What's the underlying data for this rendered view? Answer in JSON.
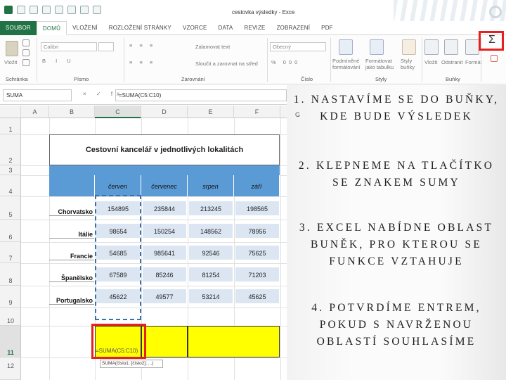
{
  "window": {
    "title": "cestovka výsledky - Exce"
  },
  "tabs": [
    {
      "label": "SOUBOR"
    },
    {
      "label": "DOMŮ"
    },
    {
      "label": "VLOŽENÍ"
    },
    {
      "label": "ROZLOŽENÍ STRÁNKY"
    },
    {
      "label": "VZORCE"
    },
    {
      "label": "DATA"
    },
    {
      "label": "REVIZE"
    },
    {
      "label": "ZOBRAZENÍ"
    },
    {
      "label": "PDF"
    }
  ],
  "ribbon": {
    "paste_label": "Vložit",
    "font_name": "Calibri",
    "wrap_text": "Zalamovat text",
    "merge_center": "Sloučit a zarovnat na střed",
    "number_format": "Obecný",
    "cond_format": "Podmíněné formátování",
    "format_table": "Formátovat jako tabulku",
    "styles_label": "Styly buňky",
    "insert_label": "Vložit",
    "delete_label": "Odstranit",
    "format_label": "Formát",
    "sigma": "Σ",
    "groups": {
      "clipboard": "Schránka",
      "font": "Písmo",
      "alignment": "Zarovnání",
      "number": "Číslo",
      "styles": "Styly",
      "cells": "Buňky"
    }
  },
  "formula_bar": {
    "name_box": "SUMA",
    "icons": "× ✓ fx",
    "formula": "=SUMA(C5:C10)"
  },
  "grid": {
    "columns": [
      "A",
      "B",
      "C",
      "D",
      "E",
      "F"
    ],
    "extra_column": "G",
    "rows": [
      "1",
      "2",
      "3",
      "4",
      "5",
      "6",
      "7",
      "8",
      "9",
      "10",
      "11",
      "12"
    ],
    "table_title": "Cestovní kancelář v jednotlivých lokalitách",
    "months": [
      "červen",
      "červenec",
      "srpen",
      "září"
    ],
    "data": [
      {
        "country": "Chorvatsko",
        "values": [
          "154895",
          "235844",
          "213245",
          "198565"
        ]
      },
      {
        "country": "Itálie",
        "values": [
          "98654",
          "150254",
          "148562",
          "78956"
        ]
      },
      {
        "country": "Francie",
        "values": [
          "54685",
          "985641",
          "92546",
          "75625"
        ]
      },
      {
        "country": "Španělsko",
        "values": [
          "67589",
          "85246",
          "81254",
          "71203"
        ]
      },
      {
        "country": "Portugalsko",
        "values": [
          "45622",
          "49577",
          "53214",
          "45625"
        ]
      }
    ],
    "sum_formula": "=SUMA(C5:C10)",
    "tooltip": "SUMA(číslo1; [číslo2]; ...)"
  },
  "steps": [
    "1. NASTAVÍME SE DO BUŇKY, KDE BUDE VÝSLEDEK",
    "2. KLEPNEME NA TLAČÍTKO SE ZNAKEM SUMY",
    "3. EXCEL NABÍDNE OBLAST BUNĚK, PRO KTEROU SE FUNKCE VZTAHUJE",
    "4. POTVRDÍME ENTREM, POKUD S NAVRŽENOU OBLASTÍ SOUHLASÍME"
  ],
  "colors": {
    "excel_green": "#217346",
    "header_blue": "#5b9bd5",
    "highlight_red": "#e5201e",
    "highlight_yellow": "#ffff00"
  }
}
